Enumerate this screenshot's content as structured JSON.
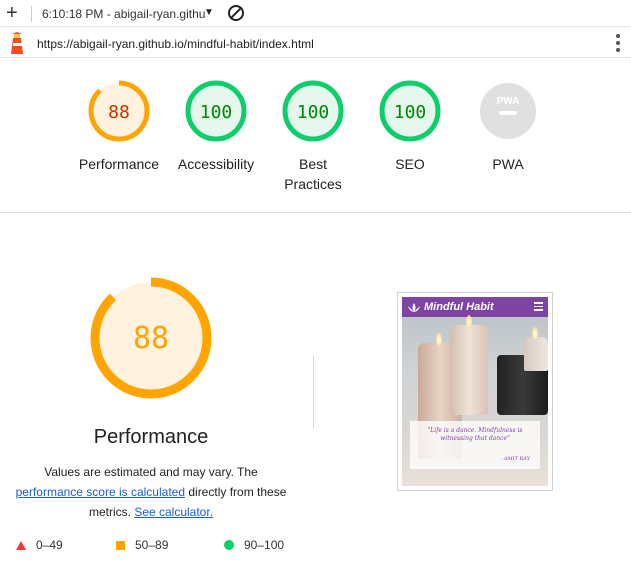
{
  "toolbar": {
    "plus_icon": "plus-icon",
    "time_title": "6:10:18 PM - abigail-ryan.githu",
    "block_icon": "no-entry-icon"
  },
  "urlbar": {
    "url": "https://abigail-ryan.github.io/mindful-habit/index.html"
  },
  "categories": [
    {
      "score": "88",
      "label": "Performance",
      "value": 0.88,
      "color": "#ffa400",
      "text_color": "#c33300",
      "fill": "#fff3e0"
    },
    {
      "score": "100",
      "label": "Accessibility",
      "value": 1.0,
      "color": "#0cce6b",
      "text_color": "#008800",
      "fill": "#e5f7ec"
    },
    {
      "score": "100",
      "label": "Best Practices",
      "value": 1.0,
      "color": "#0cce6b",
      "text_color": "#008800",
      "fill": "#e5f7ec"
    },
    {
      "score": "100",
      "label": "SEO",
      "value": 1.0,
      "color": "#0cce6b",
      "text_color": "#008800",
      "fill": "#e5f7ec"
    },
    {
      "score": "PWA",
      "label": "PWA",
      "value": 0,
      "color": "#e0e0e0",
      "text_color": "#ffffff",
      "fill": "#e0e0e0"
    }
  ],
  "main": {
    "score": "88",
    "value": 0.88,
    "title": "Performance",
    "desc_1": "Values are estimated and may vary. The",
    "desc_link_1": "performance score is calculated",
    "desc_2": " directly from these metrics. ",
    "desc_link_2": "See calculator."
  },
  "legend": [
    {
      "range": "0–49",
      "color": "#ff3333",
      "shape": "triangle"
    },
    {
      "range": "50–89",
      "color": "#ffa400",
      "shape": "square"
    },
    {
      "range": "90–100",
      "color": "#0cce6b",
      "shape": "circle"
    }
  ],
  "screenshot": {
    "site_title": "Mindful Habit",
    "quote": "\"Life is a dance. Mindfulness is witnessing that dance\"",
    "author": "- AMIT RAY"
  }
}
